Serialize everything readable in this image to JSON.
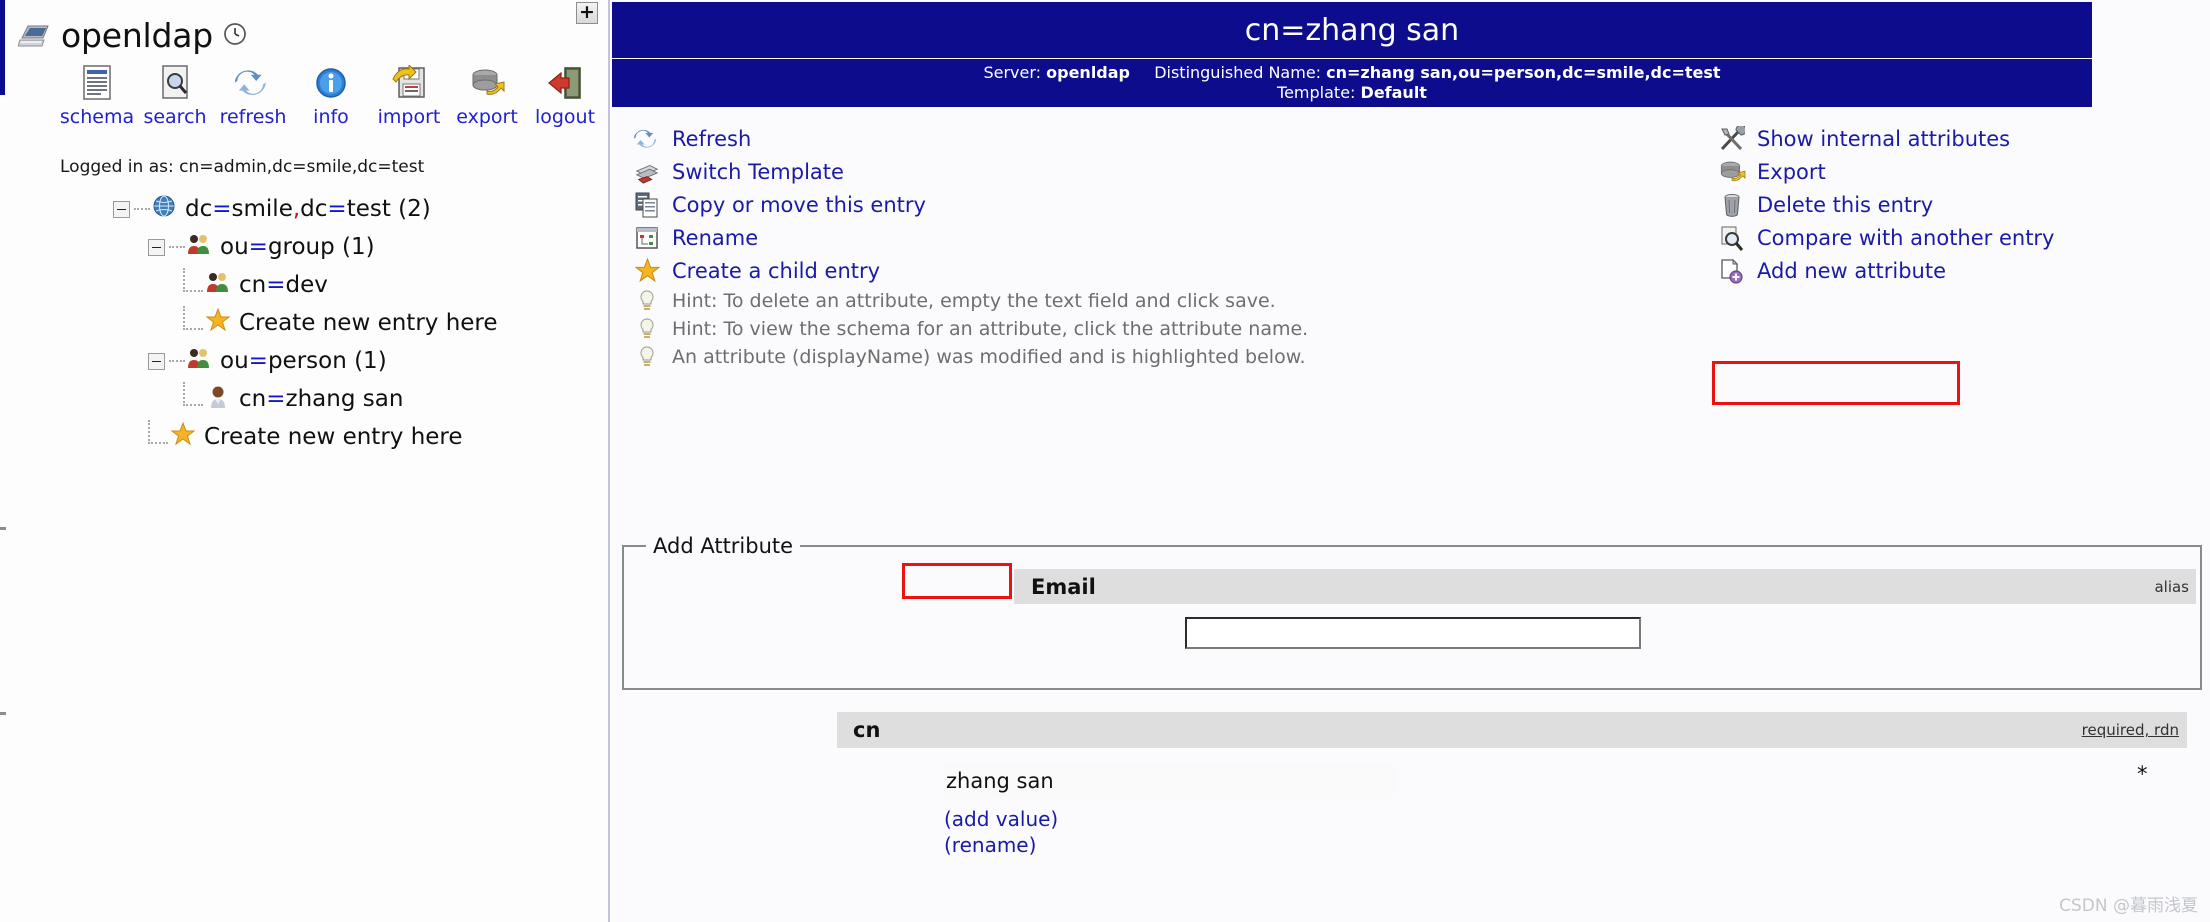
{
  "app": {
    "brand": "openldap",
    "brand_icon": "server-computer-icon",
    "clock_icon": "clock-icon",
    "plus_button": "+",
    "logged_in": "Logged in as: cn=admin,dc=smile,dc=test"
  },
  "toolbar": [
    {
      "label": "schema",
      "icon": "schema-document-icon"
    },
    {
      "label": "search",
      "icon": "search-magnifier-icon"
    },
    {
      "label": "refresh",
      "icon": "refresh-arrows-icon"
    },
    {
      "label": "info",
      "icon": "info-circle-icon"
    },
    {
      "label": "import",
      "icon": "import-floppy-icon"
    },
    {
      "label": "export",
      "icon": "export-database-icon"
    },
    {
      "label": "logout",
      "icon": "logout-door-icon"
    }
  ],
  "tree": [
    {
      "level": 0,
      "pre": "dc",
      "eq": "=",
      "mid": "smile",
      "comma": ",",
      "post": "dc=test",
      "count": "(2)",
      "icon": "globe-icon",
      "expanded": true,
      "label": "dc=smile,dc=test (2)"
    },
    {
      "level": 1,
      "label": "ou=group (1)",
      "icon": "group-people-icon",
      "expanded": true
    },
    {
      "level": 2,
      "label": "cn=dev",
      "icon": "group-people-icon"
    },
    {
      "level": 2,
      "label": "Create new entry here",
      "icon": "star-icon"
    },
    {
      "level": 1,
      "label": "ou=person (1)",
      "icon": "group-people-icon",
      "expanded": true
    },
    {
      "level": 2,
      "label": "cn=zhang san",
      "icon": "user-person-icon"
    },
    {
      "level": 1,
      "label": "Create new entry here",
      "icon": "star-icon"
    }
  ],
  "header": {
    "title": "cn=zhang san",
    "server_label": "Server:",
    "server_value": "openldap",
    "dn_label": "Distinguished Name:",
    "dn_value": "cn=zhang san,ou=person,dc=smile,dc=test",
    "template_label": "Template:",
    "template_value": "Default",
    "bg_color": "#0c0c8c",
    "text_color": "#ffffff"
  },
  "actions_left": [
    {
      "label": "Refresh",
      "icon": "refresh-arrows-icon"
    },
    {
      "label": "Switch Template",
      "icon": "switch-template-icon"
    },
    {
      "label": "Copy or move this entry",
      "icon": "copy-pages-icon"
    },
    {
      "label": "Rename",
      "icon": "rename-window-icon"
    },
    {
      "label": "Create a child entry",
      "icon": "star-icon"
    }
  ],
  "hints": [
    {
      "label": "Hint: To delete an attribute, empty the text field and click save.",
      "icon": "lightbulb-icon"
    },
    {
      "label": "Hint: To view the schema for an attribute, click the attribute name.",
      "icon": "lightbulb-icon"
    },
    {
      "label": "An attribute (displayName) was modified and is highlighted below.",
      "icon": "lightbulb-icon"
    }
  ],
  "actions_right": [
    {
      "label": "Show internal attributes",
      "icon": "tools-wrench-icon"
    },
    {
      "label": "Export",
      "icon": "export-database-icon"
    },
    {
      "label": "Delete this entry",
      "icon": "trash-bin-icon"
    },
    {
      "label": "Compare with another entry",
      "icon": "compare-magnifier-icon"
    },
    {
      "label": "Add new attribute",
      "icon": "add-attribute-icon",
      "highlighted": true
    }
  ],
  "add_attribute": {
    "legend": "Add Attribute",
    "attribute_name": "Email",
    "attribute_flags": "alias",
    "value": "",
    "highlight_color": "#ee1111"
  },
  "cn_attribute": {
    "name": "cn",
    "flags": "required, rdn",
    "value": "zhang san",
    "required_marker": "*",
    "add_value_link": "(add value)",
    "rename_link": "(rename)"
  },
  "watermark": "CSDN @暮雨浅夏"
}
